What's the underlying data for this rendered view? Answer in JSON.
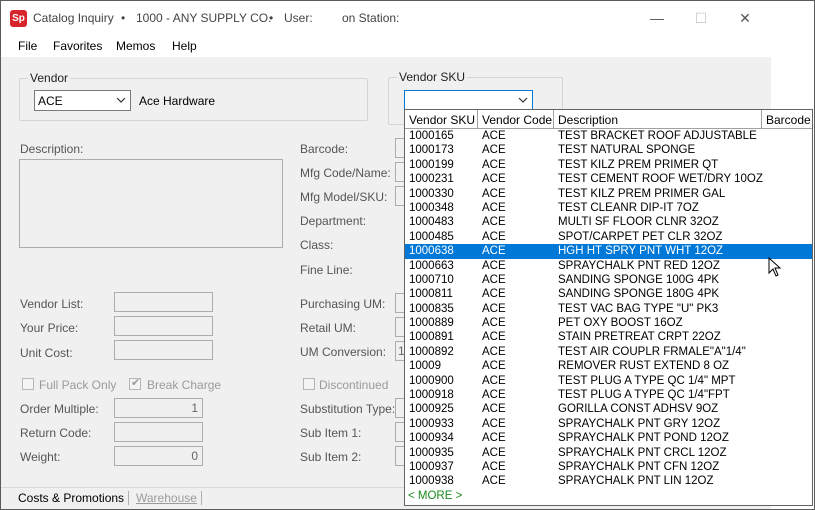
{
  "titlebar": {
    "app_icon_text": "Sp",
    "app_name": "Catalog Inquiry",
    "sep1": "•",
    "company": "1000 - ANY SUPPLY CO.",
    "sep2": "•",
    "user_label": "User:",
    "station_label": "on Station:",
    "minimize": "—",
    "maximize": "☐",
    "close": "✕"
  },
  "menu": {
    "file": "File",
    "favorites": "Favorites",
    "memos": "Memos",
    "help": "Help"
  },
  "vendor": {
    "legend": "Vendor",
    "selected": "ACE",
    "name": "Ace Hardware"
  },
  "vendor_sku": {
    "legend": "Vendor SKU",
    "value": ""
  },
  "left_labels": {
    "description": "Description:",
    "vendor_list": "Vendor List:",
    "your_price": "Your Price:",
    "unit_cost": "Unit Cost:",
    "full_pack_only": "Full Pack Only",
    "break_charge": "Break Charge",
    "order_multiple": "Order Multiple:",
    "return_code": "Return Code:",
    "weight": "Weight:"
  },
  "left_values": {
    "order_multiple": "1",
    "weight": "0"
  },
  "mid_labels": {
    "barcode": "Barcode:",
    "mfg_code_name": "Mfg Code/Name:",
    "mfg_model_sku": "Mfg Model/SKU:",
    "department": "Department:",
    "class": "Class:",
    "fine_line": "Fine Line:",
    "purchasing_um": "Purchasing UM:",
    "retail_um": "Retail UM:",
    "um_conversion": "UM Conversion:",
    "um_conversion_value": "1",
    "discontinued": "Discontinued",
    "substitution_type": "Substitution Type:",
    "sub_item_1": "Sub Item 1:",
    "sub_item_2": "Sub Item 2:"
  },
  "tabs": {
    "costs_promotions": "Costs & Promotions",
    "warehouse": "Warehouse"
  },
  "dropdown": {
    "columns": [
      "Vendor SKU",
      "Vendor Code",
      "Description",
      "Barcode"
    ],
    "selected_index": 8,
    "more_label": "< MORE >",
    "rows": [
      {
        "sku": "1000165",
        "code": "ACE",
        "desc": "TEST BRACKET ROOF ADJUSTABLE",
        "barcode": ""
      },
      {
        "sku": "1000173",
        "code": "ACE",
        "desc": "TEST NATURAL SPONGE",
        "barcode": ""
      },
      {
        "sku": "1000199",
        "code": "ACE",
        "desc": "TEST KILZ PREM PRIMER QT",
        "barcode": ""
      },
      {
        "sku": "1000231",
        "code": "ACE",
        "desc": "TEST CEMENT ROOF WET/DRY 10OZ",
        "barcode": ""
      },
      {
        "sku": "1000330",
        "code": "ACE",
        "desc": "TEST KILZ PREM PRIMER GAL",
        "barcode": ""
      },
      {
        "sku": "1000348",
        "code": "ACE",
        "desc": "TEST CLEANR DIP-IT 7OZ",
        "barcode": ""
      },
      {
        "sku": "1000483",
        "code": "ACE",
        "desc": "MULTI SF FLOOR CLNR 32OZ",
        "barcode": ""
      },
      {
        "sku": "1000485",
        "code": "ACE",
        "desc": "SPOT/CARPET PET CLR 32OZ",
        "barcode": ""
      },
      {
        "sku": "1000638",
        "code": "ACE",
        "desc": "HGH HT SPRY PNT WHT 12OZ",
        "barcode": ""
      },
      {
        "sku": "1000663",
        "code": "ACE",
        "desc": "SPRAYCHALK PNT RED 12OZ",
        "barcode": ""
      },
      {
        "sku": "1000710",
        "code": "ACE",
        "desc": "SANDING SPONGE 100G 4PK",
        "barcode": ""
      },
      {
        "sku": "1000811",
        "code": "ACE",
        "desc": "SANDING SPONGE 180G 4PK",
        "barcode": ""
      },
      {
        "sku": "1000835",
        "code": "ACE",
        "desc": "TEST VAC BAG TYPE \"U\" PK3",
        "barcode": ""
      },
      {
        "sku": "1000889",
        "code": "ACE",
        "desc": "PET OXY BOOST 16OZ",
        "barcode": ""
      },
      {
        "sku": "1000891",
        "code": "ACE",
        "desc": "STAIN PRETREAT CRPT 22OZ",
        "barcode": ""
      },
      {
        "sku": "1000892",
        "code": "ACE",
        "desc": "TEST AIR COUPLR FRMALE\"A\"1/4\"",
        "barcode": ""
      },
      {
        "sku": "10009",
        "code": "ACE",
        "desc": "REMOVER RUST EXTEND 8 OZ",
        "barcode": ""
      },
      {
        "sku": "1000900",
        "code": "ACE",
        "desc": "TEST PLUG A TYPE QC 1/4\" MPT",
        "barcode": ""
      },
      {
        "sku": "1000918",
        "code": "ACE",
        "desc": "TEST PLUG A TYPE QC 1/4\"FPT",
        "barcode": ""
      },
      {
        "sku": "1000925",
        "code": "ACE",
        "desc": "GORILLA CONST ADHSV 9OZ",
        "barcode": ""
      },
      {
        "sku": "1000933",
        "code": "ACE",
        "desc": "SPRAYCHALK PNT GRY 12OZ",
        "barcode": ""
      },
      {
        "sku": "1000934",
        "code": "ACE",
        "desc": "SPRAYCHALK PNT POND 12OZ",
        "barcode": ""
      },
      {
        "sku": "1000935",
        "code": "ACE",
        "desc": "SPRAYCHALK PNT CRCL 12OZ",
        "barcode": ""
      },
      {
        "sku": "1000937",
        "code": "ACE",
        "desc": "SPRAYCHALK PNT CFN 12OZ",
        "barcode": ""
      },
      {
        "sku": "1000938",
        "code": "ACE",
        "desc": "SPRAYCHALK PNT LIN 12OZ",
        "barcode": ""
      }
    ]
  },
  "colors": {
    "selection": "#0078d7",
    "brand_icon": "#d7262b",
    "more_link": "#1a8a1a"
  }
}
